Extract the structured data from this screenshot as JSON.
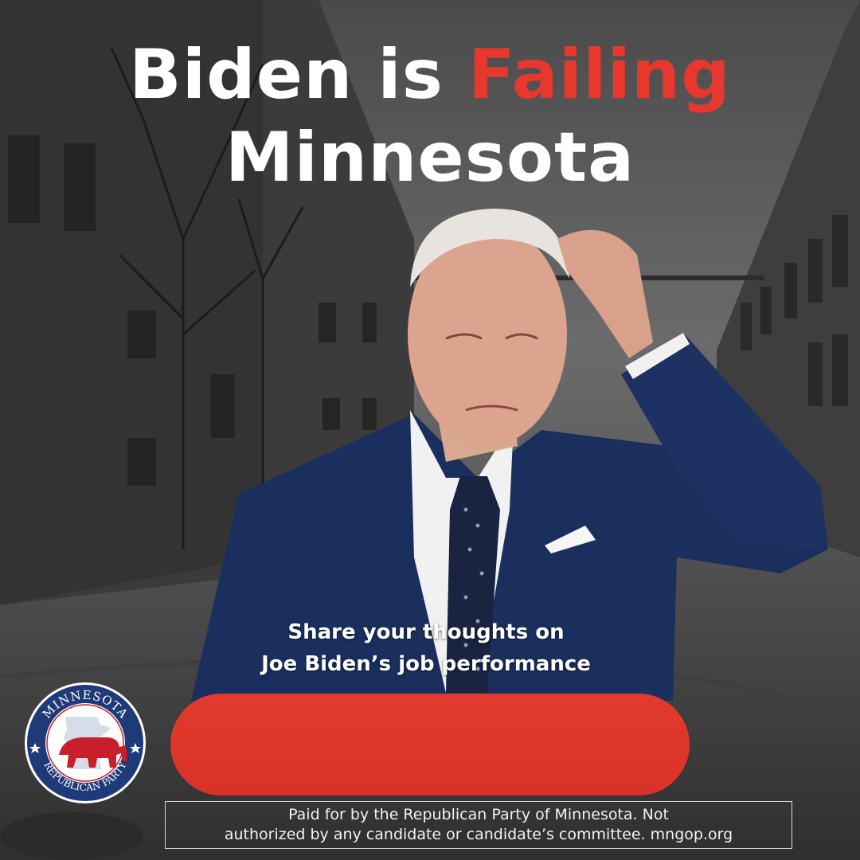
{
  "headline": {
    "line1_prefix": "Biden is ",
    "line1_accent": "Failing",
    "line2": "Minnesota"
  },
  "share_prompt": {
    "line1": "Share your thoughts on",
    "line2": "Joe Biden’s job performance"
  },
  "cta_button": {
    "label": ""
  },
  "seal": {
    "top_text": "MINNESOTA",
    "bottom_text": "REPUBLICAN PARTY"
  },
  "disclaimer": {
    "line1": "Paid for by the Republican Party of Minnesota. Not",
    "line2": "authorized by any candidate or candidate’s committee. mngop.org"
  },
  "colors": {
    "accent_red": "#e8382e",
    "button_red": "#e23a2e",
    "seal_navy": "#1f3a78",
    "suit_navy": "#1b2f5e"
  },
  "icons": [
    "elephant-icon",
    "minnesota-state-icon",
    "star-icon"
  ]
}
